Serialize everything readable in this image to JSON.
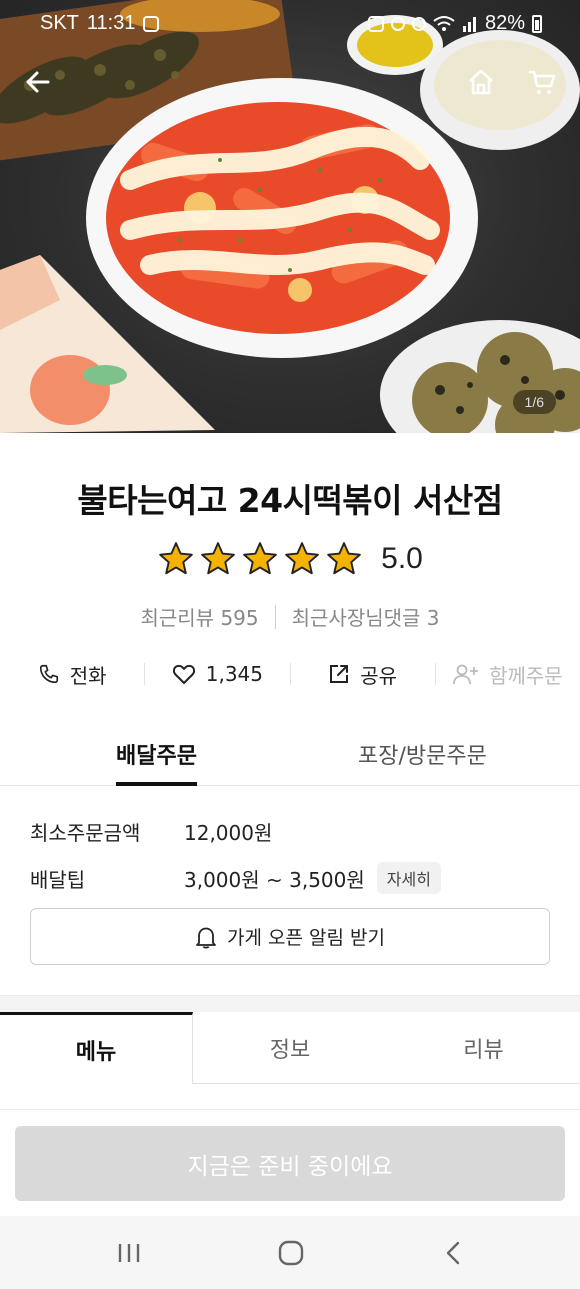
{
  "status_bar": {
    "carrier": "SKT",
    "time": "11:31",
    "battery": "82%",
    "icons": [
      "message-icon",
      "alarm-icon",
      "mute-icon",
      "hotspot-icon",
      "wifi-icon",
      "signal-icon",
      "battery-icon"
    ]
  },
  "hero": {
    "page_indicator": "1/6",
    "icons": {
      "back": "back-arrow-icon",
      "home": "home-icon",
      "cart": "cart-icon"
    }
  },
  "store": {
    "name": "불타는여고 24시떡볶이 서산점",
    "rating": "5.0",
    "rating_stars": 5,
    "recent_reviews": "최근리뷰 595",
    "owner_replies": "최근사장님댓글 3"
  },
  "actions": {
    "call": "전화",
    "likes": "1,345",
    "share": "공유",
    "group_order": "함께주문"
  },
  "order_tabs": {
    "delivery": "배달주문",
    "pickup": "포장/방문주문"
  },
  "delivery_info": {
    "min_order_label": "최소주문금액",
    "min_order_value": "12,000원",
    "tip_label": "배달팁",
    "tip_value": "3,000원 ~ 3,500원",
    "detail_label": "자세히",
    "alarm_button": "가게 오픈 알림 받기"
  },
  "menu_tabs": {
    "menu": "메뉴",
    "info": "정보",
    "review": "리뷰"
  },
  "cta": {
    "label": "지금은 준비 중이에요"
  },
  "colors": {
    "cta_disabled_bg": "#d9d9d9",
    "star": "#f5b301",
    "active_tab": "#111111"
  }
}
